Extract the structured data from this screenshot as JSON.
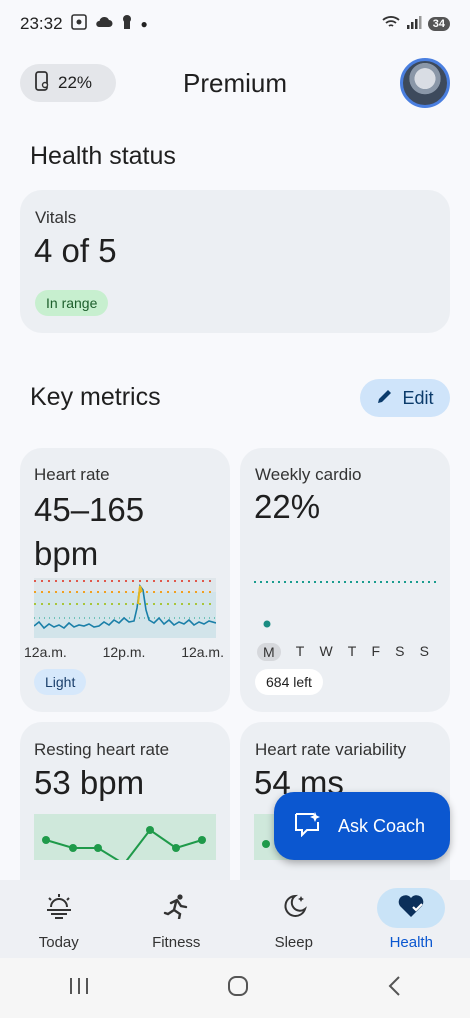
{
  "status_bar": {
    "time": "23:32",
    "battery": "34"
  },
  "header": {
    "device_battery": "22%",
    "title": "Premium"
  },
  "health_status": {
    "title": "Health status",
    "vitals_label": "Vitals",
    "vitals_value": "4 of 5",
    "vitals_chip": "In range"
  },
  "key_metrics": {
    "title": "Key metrics",
    "edit_label": "Edit"
  },
  "heart_rate": {
    "label": "Heart rate",
    "value_line1": "45–165",
    "value_line2": "bpm",
    "x_labels": [
      "12a.m.",
      "12p.m.",
      "12a.m."
    ],
    "chip": "Light"
  },
  "weekly_cardio": {
    "label": "Weekly cardio",
    "value": "22%",
    "days": [
      "M",
      "T",
      "W",
      "T",
      "F",
      "S",
      "S"
    ],
    "remaining": "684 left"
  },
  "resting_hr": {
    "label": "Resting heart rate",
    "value": "53 bpm"
  },
  "hrv": {
    "label": "Heart rate variability",
    "value": "54 ms"
  },
  "coach": {
    "label": "Ask Coach"
  },
  "nav": {
    "items": [
      {
        "label": "Today"
      },
      {
        "label": "Fitness"
      },
      {
        "label": "Sleep"
      },
      {
        "label": "Health"
      }
    ]
  },
  "colors": {
    "accent": "#0b57d0",
    "chip_green": "#c7efcf",
    "teal": "#1a8c82"
  }
}
